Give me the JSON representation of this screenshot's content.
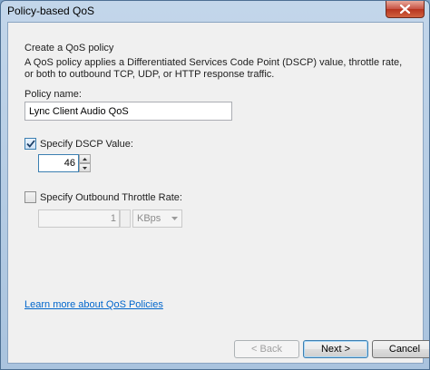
{
  "window": {
    "title": "Policy-based QoS",
    "close_icon": "close-icon"
  },
  "intro": {
    "heading": "Create a QoS policy",
    "description": "A QoS policy applies a Differentiated Services Code Point (DSCP) value, throttle rate, or both to outbound TCP, UDP, or HTTP response traffic."
  },
  "policy_name": {
    "label": "Policy name:",
    "value": "Lync Client Audio QoS"
  },
  "dscp": {
    "label": "Specify DSCP Value:",
    "checked": true,
    "value": "46"
  },
  "throttle": {
    "label": "Specify Outbound Throttle Rate:",
    "checked": false,
    "value": "1",
    "unit": "KBps"
  },
  "learn_more": "Learn more about QoS Policies",
  "buttons": {
    "back": "< Back",
    "next": "Next >",
    "cancel": "Cancel"
  },
  "colors": {
    "link": "#0066cc",
    "close_button": "#c75243"
  }
}
